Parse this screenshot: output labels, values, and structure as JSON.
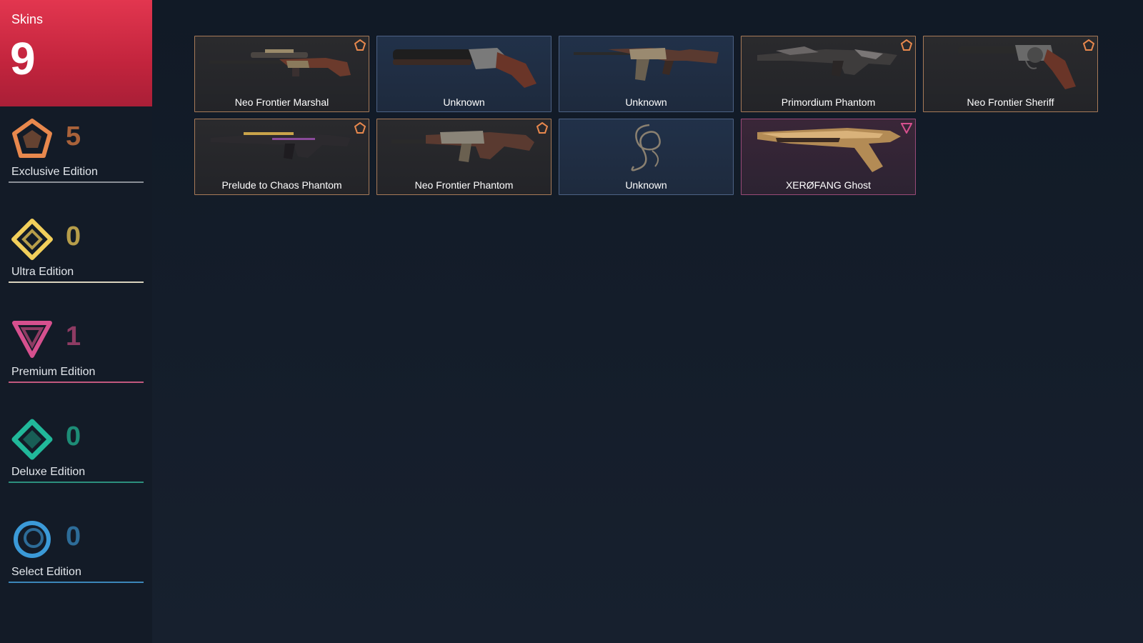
{
  "summary": {
    "label": "Skins",
    "total": "9",
    "accent_color": "#c9283f"
  },
  "editions": [
    {
      "name": "Exclusive Edition",
      "count": "5",
      "icon": "exclusive-edition-icon",
      "color": "#e8884d",
      "count_color": "#a9623a"
    },
    {
      "name": "Ultra Edition",
      "count": "0",
      "icon": "ultra-edition-icon",
      "color": "#f2cf5b",
      "count_color": "#b69d4a"
    },
    {
      "name": "Premium Edition",
      "count": "1",
      "icon": "premium-edition-icon",
      "color": "#d6508e",
      "count_color": "#8e3b63"
    },
    {
      "name": "Deluxe Edition",
      "count": "0",
      "icon": "deluxe-edition-icon",
      "color": "#21b89a",
      "count_color": "#1d8c76"
    },
    {
      "name": "Select Edition",
      "count": "0",
      "icon": "select-edition-icon",
      "color": "#3b9ad8",
      "count_color": "#2d6c98"
    }
  ],
  "skins": [
    {
      "name": "Neo Frontier Marshal",
      "tier": "exclusive",
      "weapon": "sniper-rifle"
    },
    {
      "name": "Unknown",
      "tier": "none",
      "weapon": "shotgun"
    },
    {
      "name": "Unknown",
      "tier": "none",
      "weapon": "assault-rifle"
    },
    {
      "name": "Primordium Phantom",
      "tier": "exclusive",
      "weapon": "phantom-rifle"
    },
    {
      "name": "Neo Frontier Sheriff",
      "tier": "exclusive",
      "weapon": "revolver"
    },
    {
      "name": "Prelude to Chaos Phantom",
      "tier": "exclusive",
      "weapon": "phantom-rifle"
    },
    {
      "name": "Neo Frontier Phantom",
      "tier": "exclusive",
      "weapon": "phantom-rifle"
    },
    {
      "name": "Unknown",
      "tier": "none",
      "weapon": "whip"
    },
    {
      "name": "XERØFANG Ghost",
      "tier": "premium",
      "weapon": "pistol"
    }
  ]
}
